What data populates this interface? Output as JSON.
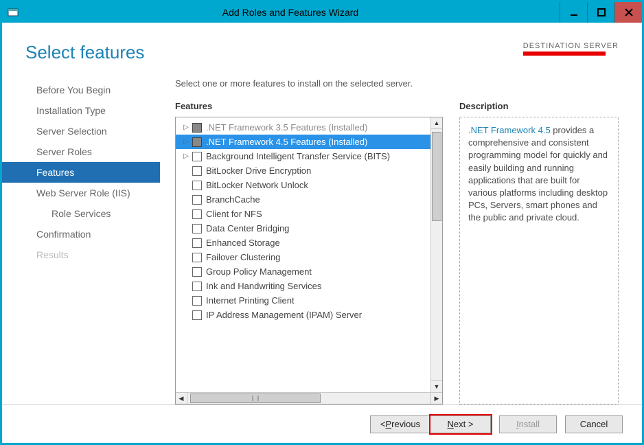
{
  "title": "Add Roles and Features Wizard",
  "page_title": "Select features",
  "destination_label": "DESTINATION SERVER",
  "instruction": "Select one or more features to install on the selected server.",
  "section_features": "Features",
  "section_description": "Description",
  "sidebar": {
    "items": [
      {
        "label": "Before You Begin",
        "active": false,
        "disabled": false,
        "sub": false,
        "name": "nav-before-you-begin"
      },
      {
        "label": "Installation Type",
        "active": false,
        "disabled": false,
        "sub": false,
        "name": "nav-installation-type"
      },
      {
        "label": "Server Selection",
        "active": false,
        "disabled": false,
        "sub": false,
        "name": "nav-server-selection"
      },
      {
        "label": "Server Roles",
        "active": false,
        "disabled": false,
        "sub": false,
        "name": "nav-server-roles"
      },
      {
        "label": "Features",
        "active": true,
        "disabled": false,
        "sub": false,
        "name": "nav-features"
      },
      {
        "label": "Web Server Role (IIS)",
        "active": false,
        "disabled": false,
        "sub": false,
        "name": "nav-web-server-role"
      },
      {
        "label": "Role Services",
        "active": false,
        "disabled": false,
        "sub": true,
        "name": "nav-role-services"
      },
      {
        "label": "Confirmation",
        "active": false,
        "disabled": false,
        "sub": false,
        "name": "nav-confirmation"
      },
      {
        "label": "Results",
        "active": false,
        "disabled": true,
        "sub": false,
        "name": "nav-results"
      }
    ]
  },
  "features": {
    "items": [
      {
        "label": ".NET Framework 3.5 Features (Installed)",
        "expandable": true,
        "partial": true,
        "installed": true,
        "selected": false
      },
      {
        "label": ".NET Framework 4.5 Features (Installed)",
        "expandable": true,
        "partial": true,
        "installed": true,
        "selected": true
      },
      {
        "label": "Background Intelligent Transfer Service (BITS)",
        "expandable": true,
        "partial": false,
        "installed": false,
        "selected": false
      },
      {
        "label": "BitLocker Drive Encryption",
        "expandable": false,
        "partial": false,
        "installed": false,
        "selected": false
      },
      {
        "label": "BitLocker Network Unlock",
        "expandable": false,
        "partial": false,
        "installed": false,
        "selected": false
      },
      {
        "label": "BranchCache",
        "expandable": false,
        "partial": false,
        "installed": false,
        "selected": false
      },
      {
        "label": "Client for NFS",
        "expandable": false,
        "partial": false,
        "installed": false,
        "selected": false
      },
      {
        "label": "Data Center Bridging",
        "expandable": false,
        "partial": false,
        "installed": false,
        "selected": false
      },
      {
        "label": "Enhanced Storage",
        "expandable": false,
        "partial": false,
        "installed": false,
        "selected": false
      },
      {
        "label": "Failover Clustering",
        "expandable": false,
        "partial": false,
        "installed": false,
        "selected": false
      },
      {
        "label": "Group Policy Management",
        "expandable": false,
        "partial": false,
        "installed": false,
        "selected": false
      },
      {
        "label": "Ink and Handwriting Services",
        "expandable": false,
        "partial": false,
        "installed": false,
        "selected": false
      },
      {
        "label": "Internet Printing Client",
        "expandable": false,
        "partial": false,
        "installed": false,
        "selected": false
      },
      {
        "label": "IP Address Management (IPAM) Server",
        "expandable": false,
        "partial": false,
        "installed": false,
        "selected": false
      }
    ]
  },
  "description": {
    "highlight": ".NET Framework 4.5",
    "rest": " provides a comprehensive and consistent programming model for quickly and easily building and running applications that are built for various platforms including desktop PCs, Servers, smart phones and the public and private cloud."
  },
  "footer": {
    "previous_pre": "< ",
    "previous_u": "P",
    "previous_post": "revious",
    "next_u": "N",
    "next_post": "ext >",
    "install_u": "I",
    "install_post": "nstall",
    "cancel": "Cancel"
  }
}
